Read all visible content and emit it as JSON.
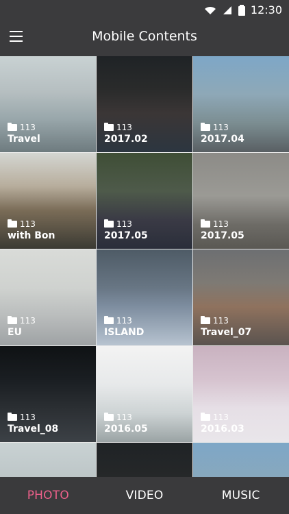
{
  "status": {
    "time": "12:30",
    "icons": [
      "wifi-icon",
      "signal-icon",
      "battery-icon"
    ]
  },
  "header": {
    "title": "Mobile Contents",
    "menu_icon": "menu-icon"
  },
  "grid": {
    "count_label": "113",
    "items": [
      {
        "label": "Travel",
        "count": "113",
        "bg": "linear-gradient(180deg,#c9d2d3 0%,#b5bec0 38%,#99a7ab 65%,#6e7b7f 100%)"
      },
      {
        "label": "2017.02",
        "count": "113",
        "bg": "linear-gradient(180deg,#1f2326 0%,#2a2b2b 35%,#3b3636 60%,#2c3640 100%)"
      },
      {
        "label": "2017.04",
        "count": "113",
        "bg": "linear-gradient(180deg,#7ea7c7 0%,#8ea8b7 40%,#7b8d91 70%,#595f63 100%)"
      },
      {
        "label": "with Bon",
        "count": "113",
        "bg": "linear-gradient(180deg,#d4d6d2 0%,#b7ad9c 35%,#7a6c57 60%,#3b3a33 100%)"
      },
      {
        "label": "2017.05",
        "count": "113",
        "bg": "linear-gradient(180deg,#3f4e36 0%,#4e5a4a 40%,#3a3a45 70%,#2a2e3a 100%)"
      },
      {
        "label": "2017.05",
        "count": "113",
        "bg": "linear-gradient(180deg,#8c8b87 0%,#9b9a95 45%,#6d6b66 75%,#5a5853 100%)"
      },
      {
        "label": "EU",
        "count": "113",
        "bg": "linear-gradient(180deg,#d9dbd8 0%,#cfd2cf 40%,#b9bcbc 70%,#9ea2a4 100%)"
      },
      {
        "label": "ISLAND",
        "count": "113",
        "bg": "linear-gradient(180deg,#4e5b66 0%,#687684 40%,#7e8ea0 60%,#b7c3d0 100%)"
      },
      {
        "label": "Travel_07",
        "count": "113",
        "bg": "linear-gradient(180deg,#6d6f72 0%,#7e7a74 35%,#8f725e 60%,#5a534f 100%)"
      },
      {
        "label": "Travel_08",
        "count": "113",
        "bg": "linear-gradient(180deg,#0f1214 0%,#1a1e22 35%,#2b2f33 65%,#3c4146 100%)"
      },
      {
        "label": "2016.05",
        "count": "113",
        "bg": "linear-gradient(180deg,#f3f3f3 0%,#e7e9ea 40%,#cdd3d4 70%,#9aa3a4 100%)"
      },
      {
        "label": "2016.03",
        "count": "113",
        "bg": "linear-gradient(180deg,#c9b2c0 0%,#d6c3cf 35%,#e6dfe6 65%,#e9e6ea 100%)"
      },
      {
        "label": "",
        "count": "",
        "bg": "linear-gradient(180deg,#c9d2d3 0%,#b5bec0 60%,#8e9a9d 100%)"
      },
      {
        "label": "",
        "count": "",
        "bg": "linear-gradient(180deg,#1f2326 0%,#2a2b2b 60%,#38383b 100%)"
      },
      {
        "label": "",
        "count": "",
        "bg": "linear-gradient(180deg,#7ea7c7 0%,#8ea8b7 60%,#6b7a7e 100%)"
      }
    ]
  },
  "tabs": [
    {
      "label": "PHOTO",
      "active": true
    },
    {
      "label": "VIDEO",
      "active": false
    },
    {
      "label": "MUSIC",
      "active": false
    }
  ],
  "colors": {
    "accent": "#ec608a",
    "bar": "#3a3a3c"
  }
}
